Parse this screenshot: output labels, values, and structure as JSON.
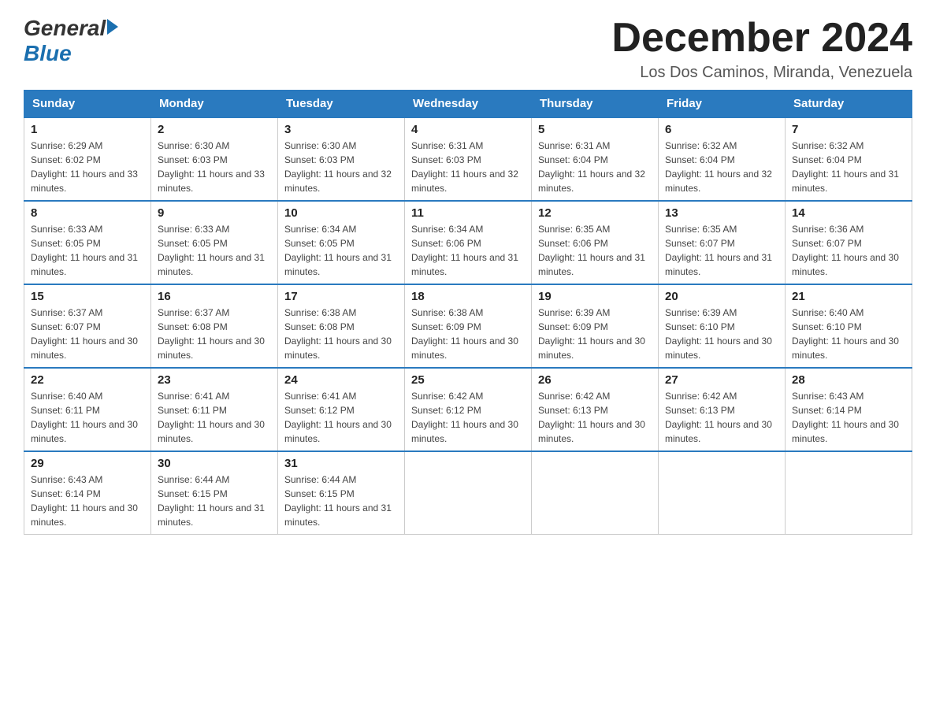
{
  "header": {
    "logo_general": "General",
    "logo_blue": "Blue",
    "month_title": "December 2024",
    "location": "Los Dos Caminos, Miranda, Venezuela"
  },
  "days_of_week": [
    "Sunday",
    "Monday",
    "Tuesday",
    "Wednesday",
    "Thursday",
    "Friday",
    "Saturday"
  ],
  "weeks": [
    [
      {
        "day": "1",
        "sunrise": "6:29 AM",
        "sunset": "6:02 PM",
        "daylight": "11 hours and 33 minutes."
      },
      {
        "day": "2",
        "sunrise": "6:30 AM",
        "sunset": "6:03 PM",
        "daylight": "11 hours and 33 minutes."
      },
      {
        "day": "3",
        "sunrise": "6:30 AM",
        "sunset": "6:03 PM",
        "daylight": "11 hours and 32 minutes."
      },
      {
        "day": "4",
        "sunrise": "6:31 AM",
        "sunset": "6:03 PM",
        "daylight": "11 hours and 32 minutes."
      },
      {
        "day": "5",
        "sunrise": "6:31 AM",
        "sunset": "6:04 PM",
        "daylight": "11 hours and 32 minutes."
      },
      {
        "day": "6",
        "sunrise": "6:32 AM",
        "sunset": "6:04 PM",
        "daylight": "11 hours and 32 minutes."
      },
      {
        "day": "7",
        "sunrise": "6:32 AM",
        "sunset": "6:04 PM",
        "daylight": "11 hours and 31 minutes."
      }
    ],
    [
      {
        "day": "8",
        "sunrise": "6:33 AM",
        "sunset": "6:05 PM",
        "daylight": "11 hours and 31 minutes."
      },
      {
        "day": "9",
        "sunrise": "6:33 AM",
        "sunset": "6:05 PM",
        "daylight": "11 hours and 31 minutes."
      },
      {
        "day": "10",
        "sunrise": "6:34 AM",
        "sunset": "6:05 PM",
        "daylight": "11 hours and 31 minutes."
      },
      {
        "day": "11",
        "sunrise": "6:34 AM",
        "sunset": "6:06 PM",
        "daylight": "11 hours and 31 minutes."
      },
      {
        "day": "12",
        "sunrise": "6:35 AM",
        "sunset": "6:06 PM",
        "daylight": "11 hours and 31 minutes."
      },
      {
        "day": "13",
        "sunrise": "6:35 AM",
        "sunset": "6:07 PM",
        "daylight": "11 hours and 31 minutes."
      },
      {
        "day": "14",
        "sunrise": "6:36 AM",
        "sunset": "6:07 PM",
        "daylight": "11 hours and 30 minutes."
      }
    ],
    [
      {
        "day": "15",
        "sunrise": "6:37 AM",
        "sunset": "6:07 PM",
        "daylight": "11 hours and 30 minutes."
      },
      {
        "day": "16",
        "sunrise": "6:37 AM",
        "sunset": "6:08 PM",
        "daylight": "11 hours and 30 minutes."
      },
      {
        "day": "17",
        "sunrise": "6:38 AM",
        "sunset": "6:08 PM",
        "daylight": "11 hours and 30 minutes."
      },
      {
        "day": "18",
        "sunrise": "6:38 AM",
        "sunset": "6:09 PM",
        "daylight": "11 hours and 30 minutes."
      },
      {
        "day": "19",
        "sunrise": "6:39 AM",
        "sunset": "6:09 PM",
        "daylight": "11 hours and 30 minutes."
      },
      {
        "day": "20",
        "sunrise": "6:39 AM",
        "sunset": "6:10 PM",
        "daylight": "11 hours and 30 minutes."
      },
      {
        "day": "21",
        "sunrise": "6:40 AM",
        "sunset": "6:10 PM",
        "daylight": "11 hours and 30 minutes."
      }
    ],
    [
      {
        "day": "22",
        "sunrise": "6:40 AM",
        "sunset": "6:11 PM",
        "daylight": "11 hours and 30 minutes."
      },
      {
        "day": "23",
        "sunrise": "6:41 AM",
        "sunset": "6:11 PM",
        "daylight": "11 hours and 30 minutes."
      },
      {
        "day": "24",
        "sunrise": "6:41 AM",
        "sunset": "6:12 PM",
        "daylight": "11 hours and 30 minutes."
      },
      {
        "day": "25",
        "sunrise": "6:42 AM",
        "sunset": "6:12 PM",
        "daylight": "11 hours and 30 minutes."
      },
      {
        "day": "26",
        "sunrise": "6:42 AM",
        "sunset": "6:13 PM",
        "daylight": "11 hours and 30 minutes."
      },
      {
        "day": "27",
        "sunrise": "6:42 AM",
        "sunset": "6:13 PM",
        "daylight": "11 hours and 30 minutes."
      },
      {
        "day": "28",
        "sunrise": "6:43 AM",
        "sunset": "6:14 PM",
        "daylight": "11 hours and 30 minutes."
      }
    ],
    [
      {
        "day": "29",
        "sunrise": "6:43 AM",
        "sunset": "6:14 PM",
        "daylight": "11 hours and 30 minutes."
      },
      {
        "day": "30",
        "sunrise": "6:44 AM",
        "sunset": "6:15 PM",
        "daylight": "11 hours and 31 minutes."
      },
      {
        "day": "31",
        "sunrise": "6:44 AM",
        "sunset": "6:15 PM",
        "daylight": "11 hours and 31 minutes."
      },
      null,
      null,
      null,
      null
    ]
  ]
}
